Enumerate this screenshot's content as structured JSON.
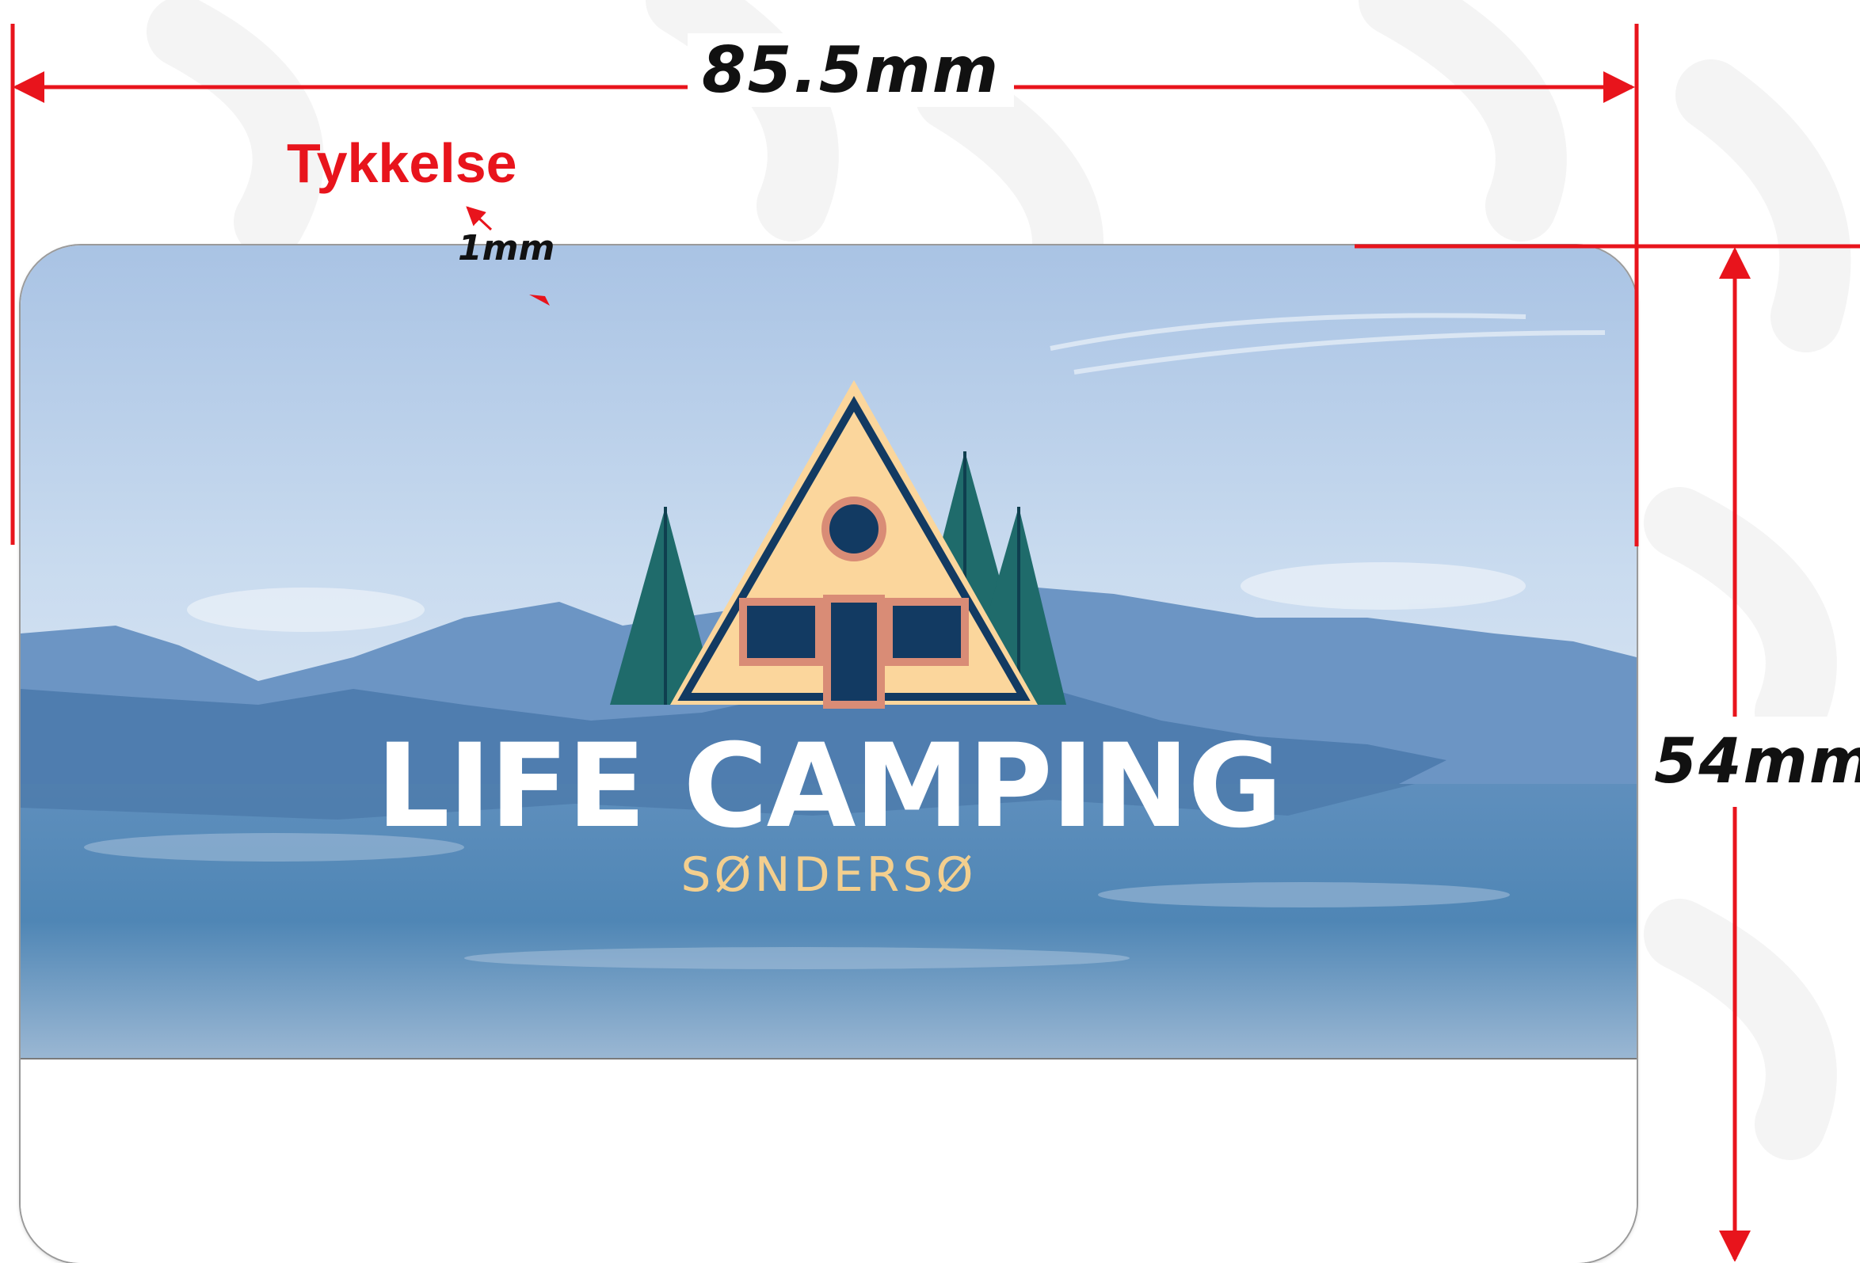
{
  "dimensions": {
    "width_label": "85.5mm",
    "height_label": "54mm",
    "thickness_title": "Tykkelse",
    "thickness_value": "1mm",
    "arrow_color": "#e8141c"
  },
  "card": {
    "title": "LIFE CAMPING",
    "subtitle": "SØNDERSØ",
    "logo_icon": "a-frame-cabin-with-pine-trees",
    "colors": {
      "title": "#ffffff",
      "subtitle": "#f3cf8e",
      "cabin": "#fbd69c",
      "cabin_trim": "#d98c76",
      "window": "#123a62",
      "trees": "#1f6b6b"
    }
  }
}
